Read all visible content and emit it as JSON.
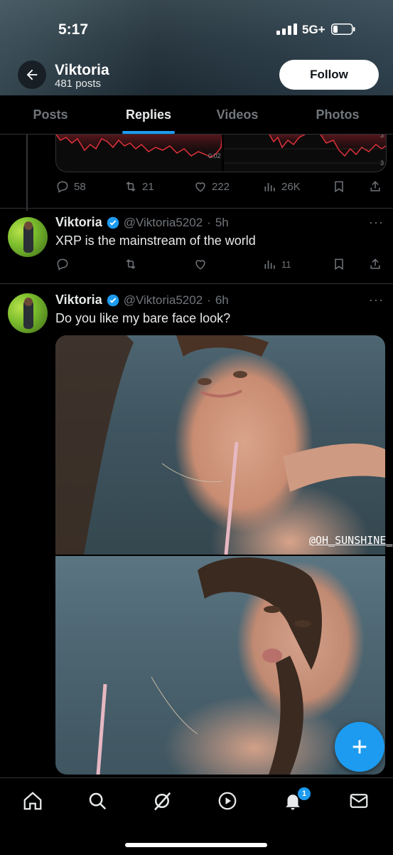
{
  "status_bar": {
    "time": "5:17",
    "network": "5G+"
  },
  "header": {
    "name": "Viktoria",
    "post_count": "481 posts",
    "follow_label": "Follow"
  },
  "tabs": [
    {
      "label": "Posts"
    },
    {
      "label": "Replies",
      "active": true
    },
    {
      "label": "Videos"
    },
    {
      "label": "Photos"
    }
  ],
  "chart_snippet": {
    "label_left": "0.02",
    "label_right_top": "3",
    "label_right_bottom": "3",
    "line_color": "#e0313a"
  },
  "tweet_0_actions": {
    "replies": "58",
    "reposts": "21",
    "likes": "222",
    "views": "26K"
  },
  "tweets": [
    {
      "name": "Viktoria",
      "handle": "@Viktoria5202",
      "time": "5h",
      "text": "XRP is the mainstream of the world",
      "views": "11"
    },
    {
      "name": "Viktoria",
      "handle": "@Viktoria5202",
      "time": "6h",
      "text": "Do you like my bare face look?",
      "watermark": "@OH_SUNSHINE_"
    }
  ],
  "notifications_badge": "1",
  "colors": {
    "accent": "#1d9bf0",
    "muted": "#71767b",
    "text": "#e7e9ea",
    "divider": "#2f3336"
  },
  "icons": [
    "back-arrow-icon",
    "reply-icon",
    "repost-icon",
    "like-icon",
    "views-icon",
    "bookmark-icon",
    "share-icon",
    "more-icon",
    "verified-icon",
    "compose-icon",
    "home-icon",
    "search-icon",
    "grok-icon",
    "video-icon",
    "bell-icon",
    "mail-icon"
  ]
}
